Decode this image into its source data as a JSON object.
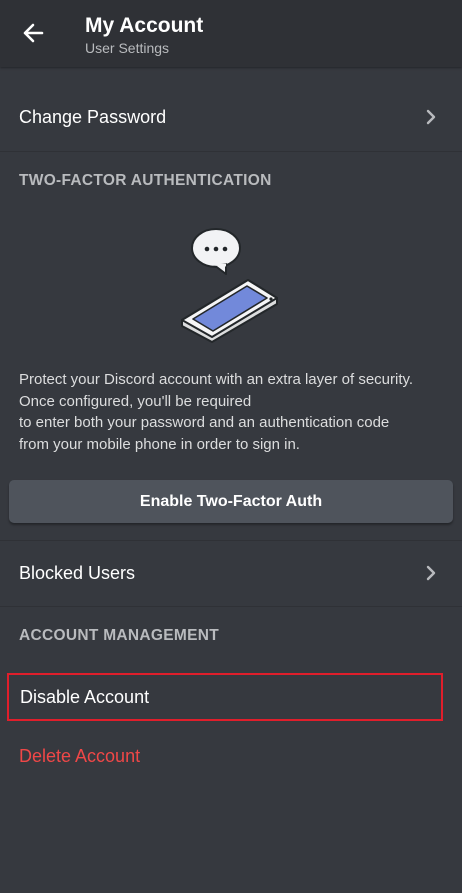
{
  "header": {
    "title": "My Account",
    "subtitle": "User Settings",
    "back_icon": "arrow-left-icon"
  },
  "rows": {
    "change_password": "Change Password",
    "blocked_users": "Blocked Users",
    "disable_account": "Disable Account",
    "delete_account": "Delete Account"
  },
  "two_factor": {
    "section_title": "TWO-FACTOR AUTHENTICATION",
    "illustration_icon": "phone-with-chat-bubble-icon",
    "description_lines": [
      "Protect your Discord account with an extra layer of security.",
      "Once configured, you'll be required",
      "to enter both your password and an authentication code",
      "from your mobile phone in order to sign in."
    ],
    "enable_button": "Enable Two-Factor Auth"
  },
  "account_management": {
    "section_title": "ACCOUNT MANAGEMENT"
  },
  "colors": {
    "background": "#36393f",
    "header_background": "#2f3136",
    "button_background": "#4f545c",
    "danger_text": "#f04747",
    "highlight_border": "#e01e2b",
    "section_header_text": "#b9bbbe"
  }
}
